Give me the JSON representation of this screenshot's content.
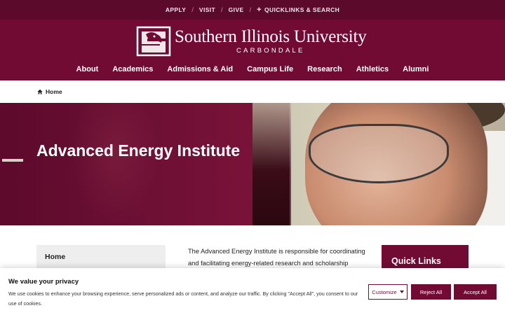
{
  "utility": {
    "links": [
      "APPLY",
      "VISIT",
      "GIVE"
    ],
    "quicklinks_label": "QUICKLINKS & SEARCH"
  },
  "logo": {
    "name": "Southern Illinois University",
    "sub": "CARBONDALE"
  },
  "nav": {
    "items": [
      "About",
      "Academics",
      "Admissions & Aid",
      "Campus Life",
      "Research",
      "Athletics",
      "Alumni"
    ]
  },
  "breadcrumb": {
    "home": "Home"
  },
  "hero": {
    "title": "Advanced Energy Institute"
  },
  "side_nav": {
    "home": "Home"
  },
  "intro": {
    "text": "The Advanced Energy Institute is responsible for coordinating and facilitating energy-related research and scholarship across"
  },
  "quick_links": {
    "title": "Quick Links"
  },
  "cookie": {
    "title": "We value your privacy",
    "text": "We use cookies to enhance your browsing experience, serve personalized ads or content, and analyze our traffic. By clicking \"Accept All\", you consent to our use of cookies.",
    "customize": "Customize",
    "reject": "Reject All",
    "accept": "Accept All"
  },
  "colors": {
    "maroon": "#720b34",
    "dark_maroon": "#5b0a2c"
  }
}
